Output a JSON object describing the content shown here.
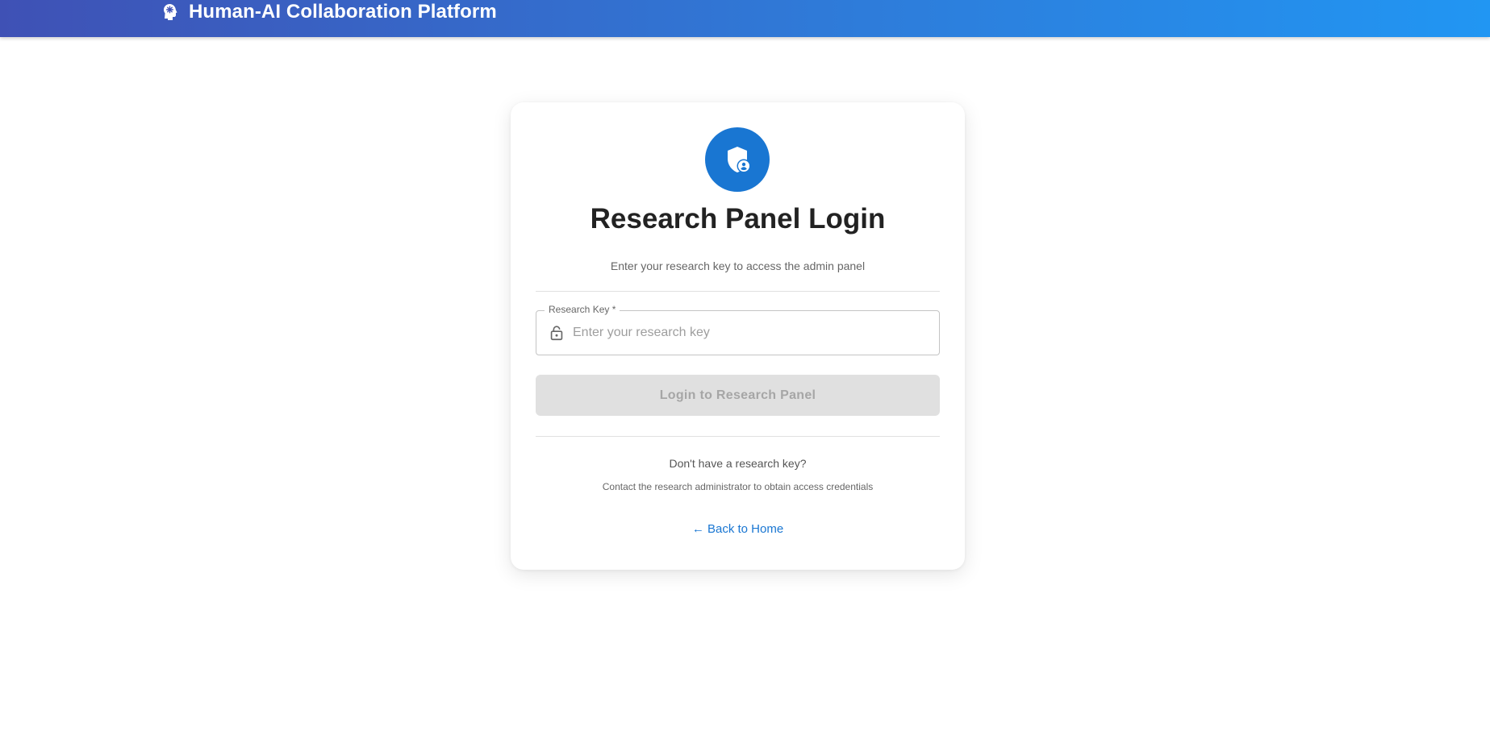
{
  "app": {
    "title": "Human-AI Collaboration Platform",
    "brand_icon": "psychology-head-icon"
  },
  "login": {
    "icon": "admin-shield-user-icon",
    "title": "Research Panel Login",
    "subtitle": "Enter your research key to access the admin panel",
    "field_label": "Research Key *",
    "field_icon": "lock-icon",
    "field_placeholder": "Enter your research key",
    "field_value": "",
    "submit_label": "Login to Research Panel",
    "help_question": "Don't have a research key?",
    "help_text": "Contact the research administrator to obtain access credentials",
    "back_link": "← Back to Home"
  },
  "colors": {
    "header_gradient_start": "#3f51b5",
    "header_gradient_end": "#2196f3",
    "accent": "#1976d2",
    "button_disabled_bg": "#e0e0e0",
    "button_disabled_text": "#a6a6a6"
  }
}
